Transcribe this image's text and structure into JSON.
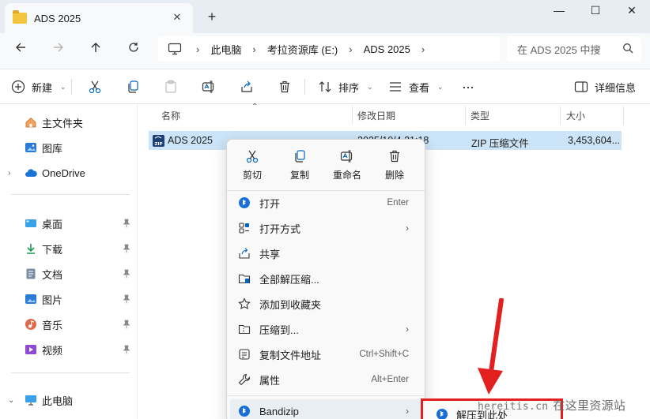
{
  "window": {
    "tab_title": "ADS 2025",
    "tab_close": "✕",
    "new_tab": "+",
    "minimize": "—",
    "maximize": "☐",
    "close": "✕"
  },
  "address": {
    "crumbs": [
      "此电脑",
      "考拉资源库 (E:)",
      "ADS 2025"
    ],
    "search_placeholder": "在 ADS 2025 中搜"
  },
  "toolbar": {
    "new_label": "新建",
    "sort_label": "排序",
    "view_label": "查看",
    "more_label": "···",
    "details_label": "详细信息"
  },
  "sidebar": {
    "items": [
      {
        "label": "主文件夹",
        "icon": "home-icon"
      },
      {
        "label": "图库",
        "icon": "gallery-icon"
      },
      {
        "label": "OneDrive",
        "icon": "cloud-icon"
      },
      {
        "label": "桌面",
        "icon": "desktop-icon"
      },
      {
        "label": "下载",
        "icon": "download-icon"
      },
      {
        "label": "文档",
        "icon": "document-icon"
      },
      {
        "label": "图片",
        "icon": "picture-icon"
      },
      {
        "label": "音乐",
        "icon": "music-icon"
      },
      {
        "label": "视频",
        "icon": "video-icon"
      },
      {
        "label": "此电脑",
        "icon": "pc-icon"
      }
    ]
  },
  "filelist": {
    "columns": [
      "名称",
      "修改日期",
      "类型",
      "大小"
    ],
    "rows": [
      {
        "name": "ADS 2025",
        "date": "2025/10/4 21:18",
        "type": "ZIP 压缩文件",
        "size": "3,453,604..."
      }
    ]
  },
  "context_menu": {
    "quick_actions": [
      "剪切",
      "复制",
      "重命名",
      "删除"
    ],
    "items": [
      {
        "label": "打开",
        "shortcut": "Enter",
        "icon": "bandizip-icon"
      },
      {
        "label": "打开方式",
        "icon": "open-with-icon"
      },
      {
        "label": "共享",
        "icon": "share-icon"
      },
      {
        "label": "全部解压缩...",
        "icon": "extract-all-icon"
      },
      {
        "label": "添加到收藏夹",
        "icon": "star-icon"
      },
      {
        "label": "压缩到...",
        "icon": "compress-icon"
      },
      {
        "label": "复制文件地址",
        "shortcut": "Ctrl+Shift+C",
        "icon": "copy-path-icon"
      },
      {
        "label": "属性",
        "shortcut": "Alt+Enter",
        "icon": "wrench-icon"
      },
      {
        "label": "Bandizip",
        "icon": "bandizip-icon"
      }
    ],
    "submenu_arrow": "›"
  },
  "submenu": {
    "item_label": "解压到此处"
  },
  "watermark": {
    "url": "hereitis.cn",
    "text": "在这里资源站"
  },
  "colors": {
    "selection": "#cce4f7",
    "annotation": "#e32020",
    "accent": "#0067c0"
  }
}
